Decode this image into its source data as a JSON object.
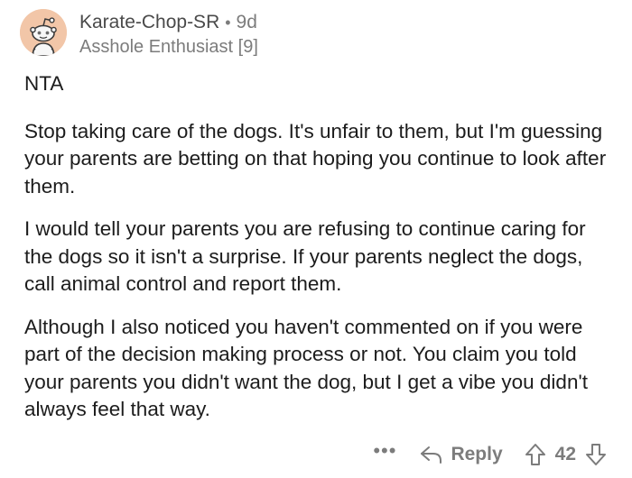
{
  "comment": {
    "author": "Karate-Chop-SR",
    "separator": "•",
    "age": "9d",
    "flair": "Asshole Enthusiast [9]",
    "paragraphs": [
      "NTA",
      "Stop taking care of the dogs. It's unfair to them, but I'm guessing your parents are betting on that hoping you continue to look after them.",
      "I would tell your parents you are refusing to continue caring for the dogs so it isn't a surprise. If your parents neglect the dogs, call animal control and report them.",
      "Although I also noticed you haven't commented on if you were part of the decision making process or not. You claim you told your parents you didn't want the dog, but I get a vibe you didn't always feel that way."
    ]
  },
  "actions": {
    "more": "•••",
    "reply_label": "Reply",
    "score": "42"
  },
  "icons": {
    "more": "more-options-icon",
    "reply": "reply-arrow-icon",
    "upvote": "upvote-arrow-icon",
    "downvote": "downvote-arrow-icon",
    "avatar": "snoo-avatar"
  },
  "colors": {
    "text": "#1c1c1c",
    "meta": "#7c7c7c",
    "avatar_bg": "#f2c6a8"
  }
}
